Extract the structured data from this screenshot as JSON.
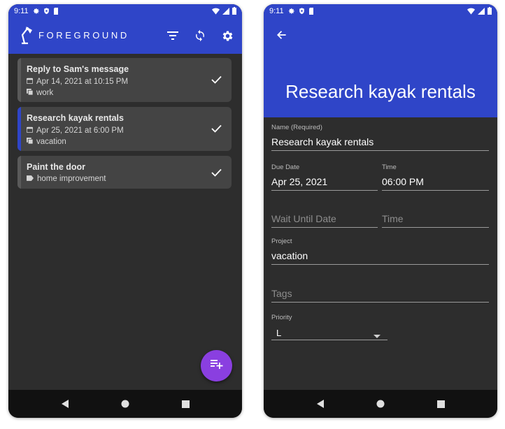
{
  "status_bar": {
    "time": "9:11"
  },
  "list_screen": {
    "app_title": "FOREGROUND",
    "tasks": [
      {
        "title": "Reply to Sam's message",
        "due": "Apr 14, 2021 at 10:15 PM",
        "project": "work",
        "stripe_color": "#5a5a5a"
      },
      {
        "title": "Research kayak rentals",
        "due": "Apr 25, 2021 at 6:00 PM",
        "project": "vacation",
        "stripe_color": "#2f45c8"
      },
      {
        "title": "Paint the door",
        "tag": "home improvement",
        "stripe_color": "#5a5a5a"
      }
    ]
  },
  "detail_screen": {
    "title": "Research kayak rentals",
    "name": {
      "label": "Name (Required)",
      "value": "Research kayak rentals"
    },
    "due_date": {
      "label": "Due Date",
      "value": "Apr 25, 2021"
    },
    "due_time": {
      "label": "Time",
      "value": "06:00 PM"
    },
    "wait_until": {
      "placeholder": "Wait Until Date"
    },
    "wait_time": {
      "placeholder": "Time"
    },
    "project": {
      "label": "Project",
      "value": "vacation"
    },
    "tags": {
      "placeholder": "Tags"
    },
    "priority": {
      "label": "Priority",
      "value": "L"
    }
  },
  "colors": {
    "accent": "#2f45c8",
    "fab": "#8a3fe0",
    "background": "#2d2d2d",
    "card": "#444444"
  },
  "icons": [
    "lamp-logo-icon",
    "filter-icon",
    "sync-icon",
    "settings-icon",
    "check-icon",
    "calendar-icon",
    "project-icon",
    "tag-icon",
    "add-task-icon",
    "back-arrow-icon",
    "nav-back-icon",
    "nav-home-icon",
    "nav-recents-icon"
  ]
}
